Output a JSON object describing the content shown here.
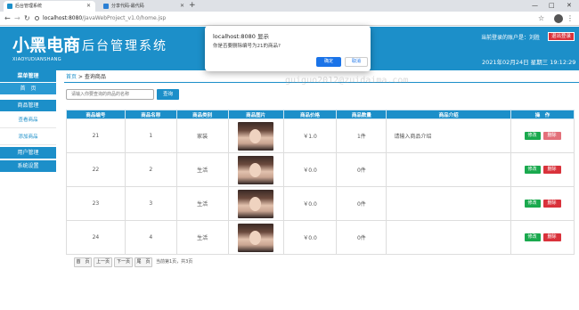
{
  "browser": {
    "tabs": [
      {
        "label": "后台管理系统",
        "active": true
      },
      {
        "label": "分享代码-最代码",
        "active": false
      }
    ],
    "new_tab": "+",
    "url_host": "localhost:8080",
    "url_path": "/JavaWebProject_v1.0/home.jsp",
    "controls": {
      "minimize": "—",
      "maximize": "□",
      "close": "✕"
    }
  },
  "header": {
    "logo_text": "小黑电商",
    "logo_sub": "XIAOYUDIANSHANG",
    "system_title": "后台管理系统",
    "login_info": "当前登录的账户是：刘胜",
    "logout": "退出登录",
    "datetime": "2021年02月24日 星期三 19:12:29"
  },
  "sidebar": {
    "title": "菜单管理",
    "home": "首　页",
    "goods_manage": "商品管理",
    "goods_query": "查看商品",
    "goods_add": "添加商品",
    "user_manage": "用户管理",
    "system_settings": "系统设置"
  },
  "breadcrumb": {
    "home": "首页",
    "sep": " > ",
    "current": "查询商品"
  },
  "search": {
    "placeholder": "请输入你要查询的商品的名称",
    "button": "查询"
  },
  "table": {
    "headers": [
      "商品编号",
      "商品名称",
      "商品类别",
      "商品图片",
      "商品价格",
      "商品数量",
      "商品介绍",
      "操　作"
    ],
    "rows": [
      {
        "id": "21",
        "name": "1",
        "category": "家装",
        "price": "￥1.0",
        "qty": "1件",
        "intro": "请输入商品介绍"
      },
      {
        "id": "22",
        "name": "2",
        "category": "生活",
        "price": "￥0.0",
        "qty": "0件",
        "intro": ""
      },
      {
        "id": "23",
        "name": "3",
        "category": "生活",
        "price": "￥0.0",
        "qty": "0件",
        "intro": ""
      },
      {
        "id": "24",
        "name": "4",
        "category": "生活",
        "price": "￥0.0",
        "qty": "0件",
        "intro": ""
      }
    ],
    "edit_label": "修改",
    "delete_label": "删除"
  },
  "pager": {
    "first": "首　页",
    "prev": "上一页",
    "next": "下一页",
    "last": "尾　页",
    "info": "当前第1页，共3页"
  },
  "watermark": "guiguo2012@zuidaima.com",
  "dialog": {
    "title": "localhost:8080 显示",
    "message": "你是否要删除编号为21的商品?",
    "ok": "确定",
    "cancel": "取消"
  },
  "colors": {
    "brand": "#1c8fc9",
    "danger": "#d9323b",
    "success": "#1aa94e",
    "dialog_primary": "#1a73e8"
  }
}
